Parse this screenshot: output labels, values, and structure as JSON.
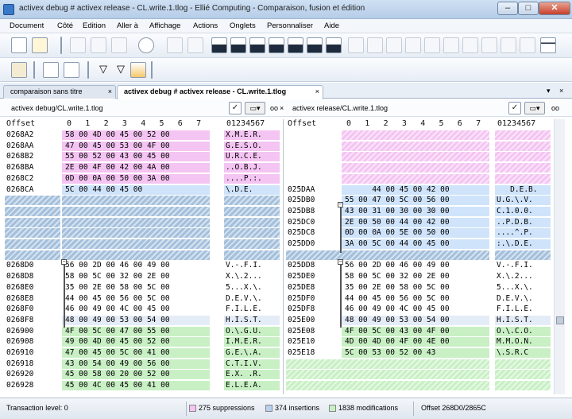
{
  "window": {
    "title": "activex debug # activex release - CL.write.1.tlog - Ellié Computing - Comparaison, fusion et édition"
  },
  "menu": [
    "Document",
    "Côté",
    "Edition",
    "Aller à",
    "Affichage",
    "Actions",
    "Onglets",
    "Personnaliser",
    "Aide"
  ],
  "tabs": [
    {
      "label": "comparaison sans titre",
      "close": "×"
    },
    {
      "label": "activex debug # activex release - CL.write.1.tlog",
      "close": "×"
    }
  ],
  "tab_controls": {
    "pin": "▾",
    "close": "×"
  },
  "left_path": "activex debug/CL.write.1.tlog",
  "right_path": "activex release/CL.write.1.tlog",
  "path_close": "×",
  "glasses": "oo",
  "colors": {
    "deleted": "#f4c4f2",
    "changed": "#cfe3fb",
    "moved": "#a4c0dc",
    "inserted": "#c8f0c4",
    "highlight": "#b9ccec"
  },
  "header": {
    "offset": "Offset",
    "cols": [
      "0",
      "1",
      "2",
      "3",
      "4",
      "5",
      "6",
      "7"
    ],
    "ascii": "01234567"
  },
  "left_rows": [
    {
      "offset": "0268A2",
      "bytes": "58 00 4D 00 45 00 52 00",
      "ascii": "X.M.E.R.",
      "type": "deleted"
    },
    {
      "offset": "0268AA",
      "bytes": "47 00 45 00 53 00 4F 00",
      "ascii": "G.E.S.O.",
      "type": "deleted"
    },
    {
      "offset": "0268B2",
      "bytes": "55 00 52 00 43 00 45 00",
      "ascii": "U.R.C.E.",
      "type": "deleted"
    },
    {
      "offset": "0268BA",
      "bytes": "2E 00 4F 00 42 00 4A 00",
      "ascii": "..O.B.J.",
      "type": "deleted"
    },
    {
      "offset": "0268C2",
      "bytes": "0D 00 0A 00 50 00 3A 00",
      "ascii": "....P.:.",
      "type": "deleted"
    },
    {
      "offset": "0268CA",
      "bytes": "5C 00 44 00 45 00",
      "ascii": "\\.D.E.",
      "type": "moved"
    },
    {
      "offset": "",
      "bytes": "",
      "ascii": "",
      "type": "moved"
    },
    {
      "offset": "",
      "bytes": "",
      "ascii": "",
      "type": "moved"
    },
    {
      "offset": "",
      "bytes": "",
      "ascii": "",
      "type": "moved"
    },
    {
      "offset": "",
      "bytes": "",
      "ascii": "",
      "type": "moved"
    },
    {
      "offset": "",
      "bytes": "",
      "ascii": "",
      "type": "moved"
    },
    {
      "offset": "",
      "bytes": "",
      "ascii": "",
      "type": "moved"
    },
    {
      "offset": "0268D0",
      "bytes": "56 00 2D 00 46 00 49 00",
      "ascii": "V.-.F.I.",
      "type": "equal"
    },
    {
      "offset": "0268D8",
      "bytes": "58 00 5C 00 32 00 2E 00",
      "ascii": "X.\\.2...",
      "type": "equal"
    },
    {
      "offset": "0268E0",
      "bytes": "35 00 2E 00 58 00 5C 00",
      "ascii": "5...X.\\.",
      "type": "equal"
    },
    {
      "offset": "0268E8",
      "bytes": "44 00 45 00 56 00 5C 00",
      "ascii": "D.E.V.\\.",
      "type": "equal"
    },
    {
      "offset": "0268F0",
      "bytes": "46 00 49 00 4C 00 45 00",
      "ascii": "F.I.L.E.",
      "type": "equal"
    },
    {
      "offset": "0268F8",
      "bytes": "48 00 49 00 53 00 54 00",
      "ascii": "H.I.S.T.",
      "type": "equal-hl"
    },
    {
      "offset": "026900",
      "bytes": "4F 00 5C 00 47 00 55 00",
      "ascii": "O.\\.G.U.",
      "type": "modified"
    },
    {
      "offset": "026908",
      "bytes": "49 00 4D 00 45 00 52 00",
      "ascii": "I.M.E.R.",
      "type": "modified"
    },
    {
      "offset": "026910",
      "bytes": "47 00 45 00 5C 00 41 00",
      "ascii": "G.E.\\.A.",
      "type": "modified"
    },
    {
      "offset": "026918",
      "bytes": "43 00 54 00 49 00 56 00",
      "ascii": "C.T.I.V.",
      "type": "modified"
    },
    {
      "offset": "026920",
      "bytes": "45 00 58 00 20 00 52 00",
      "ascii": "E.X. .R.",
      "type": "modified"
    },
    {
      "offset": "026928",
      "bytes": "45 00 4C 00 45 00 41 00",
      "ascii": "E.L.E.A.",
      "type": "modified"
    }
  ],
  "right_rows": [
    {
      "offset": "",
      "bytes": "",
      "ascii": "",
      "type": "deleted"
    },
    {
      "offset": "",
      "bytes": "",
      "ascii": "",
      "type": "deleted"
    },
    {
      "offset": "",
      "bytes": "",
      "ascii": "",
      "type": "deleted"
    },
    {
      "offset": "",
      "bytes": "",
      "ascii": "",
      "type": "deleted"
    },
    {
      "offset": "",
      "bytes": "",
      "ascii": "",
      "type": "deleted"
    },
    {
      "offset": "025DAA",
      "bytes": "      44 00 45 00 42 00",
      "ascii": "   D.E.B.",
      "type": "moved"
    },
    {
      "offset": "025DB0",
      "bytes": "55 00 47 00 5C 00 56 00",
      "ascii": "U.G.\\.V.",
      "type": "moved"
    },
    {
      "offset": "025DB8",
      "bytes": "43 00 31 00 30 00 30 00",
      "ascii": "C.1.0.0.",
      "type": "moved"
    },
    {
      "offset": "025DC0",
      "bytes": "2E 00 50 00 44 00 42 00",
      "ascii": "..P.D.B.",
      "type": "moved"
    },
    {
      "offset": "025DC8",
      "bytes": "0D 00 0A 00 5E 00 50 00",
      "ascii": "....^.P.",
      "type": "moved"
    },
    {
      "offset": "025DD0",
      "bytes": "3A 00 5C 00 44 00 45 00",
      "ascii": ":.\\.D.E.",
      "type": "moved"
    },
    {
      "offset": "",
      "bytes": "",
      "ascii": "",
      "type": "moved"
    },
    {
      "offset": "025DD8",
      "bytes": "56 00 2D 00 46 00 49 00",
      "ascii": "V.-.F.I.",
      "type": "equal"
    },
    {
      "offset": "025DE0",
      "bytes": "58 00 5C 00 32 00 2E 00",
      "ascii": "X.\\.2...",
      "type": "equal"
    },
    {
      "offset": "025DE8",
      "bytes": "35 00 2E 00 58 00 5C 00",
      "ascii": "5...X.\\.",
      "type": "equal"
    },
    {
      "offset": "025DF0",
      "bytes": "44 00 45 00 56 00 5C 00",
      "ascii": "D.E.V.\\.",
      "type": "equal"
    },
    {
      "offset": "025DF8",
      "bytes": "46 00 49 00 4C 00 45 00",
      "ascii": "F.I.L.E.",
      "type": "equal"
    },
    {
      "offset": "025E00",
      "bytes": "48 00 49 00 53 00 54 00",
      "ascii": "H.I.S.T.",
      "type": "equal-hl"
    },
    {
      "offset": "025E08",
      "bytes": "4F 00 5C 00 43 00 4F 00",
      "ascii": "O.\\.C.O.",
      "type": "modified"
    },
    {
      "offset": "025E10",
      "bytes": "4D 00 4D 00 4F 00 4E 00",
      "ascii": "M.M.O.N.",
      "type": "modified"
    },
    {
      "offset": "025E18",
      "bytes": "5C 00 53 00 52 00 43",
      "ascii": "\\.S.R.C",
      "type": "modified"
    },
    {
      "offset": "",
      "bytes": "",
      "ascii": "",
      "type": "modified"
    },
    {
      "offset": "",
      "bytes": "",
      "ascii": "",
      "type": "modified"
    },
    {
      "offset": "",
      "bytes": "",
      "ascii": "",
      "type": "modified"
    }
  ],
  "status": {
    "transaction": "Transaction level: 0",
    "suppressions": "275 suppressions",
    "insertions": "374 insertions",
    "modifications": "1838 modifications",
    "offset": "Offset 268D0/2865C"
  }
}
